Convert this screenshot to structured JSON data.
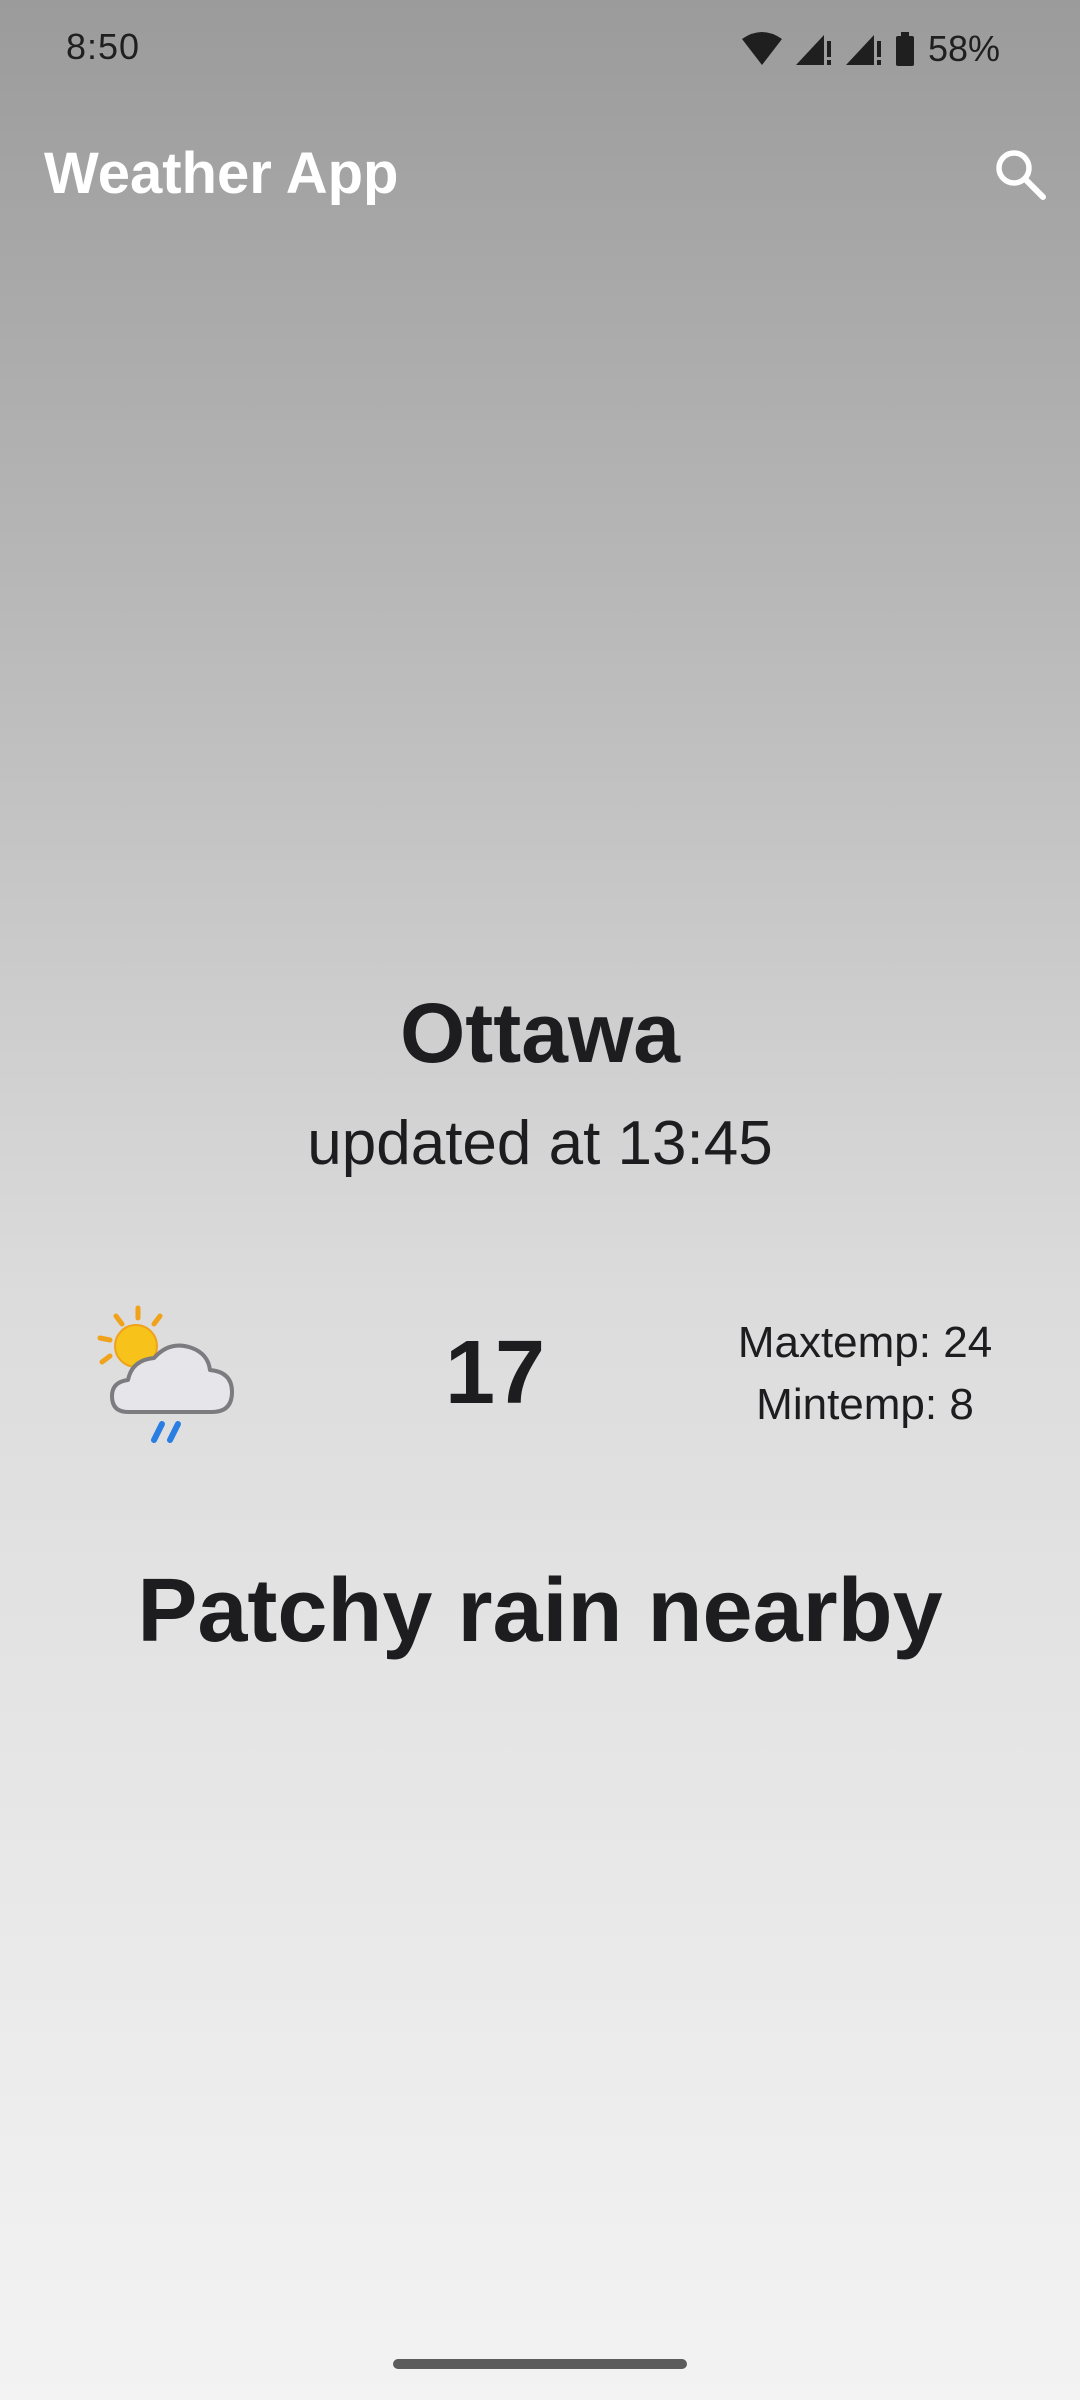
{
  "status_bar": {
    "time": "8:50",
    "battery": "58%",
    "icons": [
      "wifi-icon",
      "cell-signal-icon",
      "cell-signal-icon",
      "battery-icon"
    ]
  },
  "app_bar": {
    "title": "Weather App",
    "search_icon": "search-icon"
  },
  "weather": {
    "city": "Ottawa",
    "updated": "updated at 13:45",
    "icon": "partly-cloudy-rain-icon",
    "temperature": "17",
    "max_temp": "Maxtemp: 24",
    "min_temp": "Mintemp: 8",
    "condition": "Patchy rain nearby"
  },
  "colors": {
    "app_title": "#ffffff",
    "text": "#1d1c1f",
    "sun": "#f7c21a",
    "rain": "#2a7de1"
  }
}
